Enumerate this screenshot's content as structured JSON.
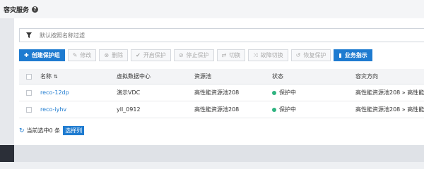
{
  "header": {
    "title": "容灾服务",
    "help_icon": "question-circle-icon"
  },
  "filter": {
    "placeholder": "默认按照名称过滤",
    "icon": "filter-icon"
  },
  "toolbar": {
    "create": "创建保护组",
    "edit": "修改",
    "delete": "删除",
    "enable": "开启保护",
    "stop": "停止保护",
    "switch": "切换",
    "failover": "故障切换",
    "restore": "恢复保护",
    "business": "业务指示"
  },
  "table": {
    "columns": [
      "名称",
      "虚拟数据中心",
      "资源池",
      "状态",
      "容灾方向"
    ],
    "rows": [
      {
        "name": "reco-12dp",
        "dc": "演示VDC",
        "pool": "高性能资源池208",
        "status": "保护中",
        "direction": "高性能资源池208 » 高性能资"
      },
      {
        "name": "reco-iyhv",
        "dc": "yll_0912",
        "pool": "高性能资源池208",
        "status": "保护中",
        "direction": "高性能资源池208 » 高性能资"
      }
    ]
  },
  "footer": {
    "selected": "当前选中0 条",
    "select_columns": "选择列"
  },
  "colors": {
    "accent": "#1e7bd0",
    "status_ok": "#2fb380"
  }
}
